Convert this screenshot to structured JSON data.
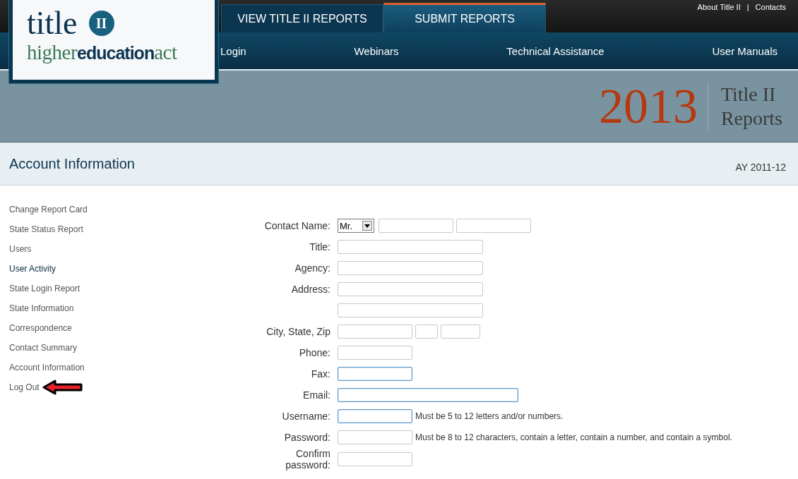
{
  "logo": {
    "word": "title",
    "badge": "II",
    "tagline_start": "higher",
    "tagline_bold": "education",
    "tagline_end": "act"
  },
  "tabs": [
    {
      "label": "VIEW TITLE II REPORTS",
      "selected": false
    },
    {
      "label": "SUBMIT REPORTS",
      "selected": true
    }
  ],
  "top_links": [
    "About Title II",
    "|",
    "Contacts"
  ],
  "nav": [
    "Login",
    "Webinars",
    "Technical Assistance",
    "User Manuals"
  ],
  "banner": {
    "year": "2013",
    "title_line1": "Title II",
    "title_line2": "Reports"
  },
  "page_header": {
    "title": "Account Information",
    "year": "AY 2011-12"
  },
  "sidebar": {
    "items": [
      {
        "label": "Change Report Card",
        "hovered": false,
        "pointed": false
      },
      {
        "label": "State Status Report",
        "hovered": false,
        "pointed": false
      },
      {
        "label": "Users",
        "hovered": false,
        "pointed": false
      },
      {
        "label": "User Activity",
        "hovered": true,
        "pointed": false
      },
      {
        "label": "State Login Report",
        "hovered": false,
        "pointed": false
      },
      {
        "label": "State Information",
        "hovered": false,
        "pointed": false
      },
      {
        "label": "Correspondence",
        "hovered": false,
        "pointed": false
      },
      {
        "label": "Contact Summary",
        "hovered": false,
        "pointed": false
      },
      {
        "label": "Account Information",
        "hovered": false,
        "pointed": false
      },
      {
        "label": "Log Out",
        "hovered": false,
        "pointed": true
      }
    ]
  },
  "form": {
    "rows": [
      {
        "label": "Contact Name:",
        "fields": [
          {
            "kind": "select",
            "value": "Mr."
          },
          {
            "kind": "name",
            "highlighted": false
          },
          {
            "kind": "name",
            "highlighted": false
          }
        ]
      },
      {
        "label": "Title:",
        "fields": [
          {
            "kind": "wide",
            "highlighted": false
          }
        ]
      },
      {
        "label": "Agency:",
        "fields": [
          {
            "kind": "wide",
            "highlighted": false
          }
        ]
      },
      {
        "label": "Address:",
        "fields": [
          {
            "kind": "wide",
            "highlighted": false
          }
        ]
      },
      {
        "fields": [
          {
            "kind": "wide",
            "highlighted": false
          }
        ]
      },
      {
        "label": "City, State, Zip",
        "fields": [
          {
            "kind": "medium",
            "highlighted": false
          },
          {
            "kind": "tiny",
            "highlighted": false
          },
          {
            "kind": "zip",
            "highlighted": false
          }
        ]
      },
      {
        "label": "Phone:",
        "fields": [
          {
            "kind": "medium",
            "highlighted": false
          }
        ]
      },
      {
        "label": "Fax:",
        "fields": [
          {
            "kind": "medium",
            "highlighted": true
          }
        ]
      },
      {
        "label": "Email:",
        "fields": [
          {
            "kind": "xwide",
            "highlighted": true
          }
        ]
      },
      {
        "label": "Username:",
        "fields": [
          {
            "kind": "medium",
            "highlighted": true
          }
        ],
        "hint": "Must be 5 to 12 letters and/or numbers."
      },
      {
        "label": "Password:",
        "fields": [
          {
            "kind": "password",
            "highlighted": false
          }
        ],
        "hint": "Must be 8 to 12 characters, contain a letter, contain a number, and contain a symbol."
      },
      {
        "label": "Confirm password:",
        "fields": [
          {
            "kind": "password",
            "highlighted": false
          }
        ]
      }
    ]
  }
}
